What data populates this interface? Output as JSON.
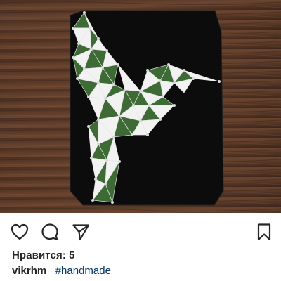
{
  "post": {
    "image_alt": "",
    "likes_label": "Нравится: 5",
    "username": "vikrhm_",
    "caption_tag": "#handmade"
  },
  "actions": {
    "like_icon": "heart-icon",
    "comment_icon": "comment-icon",
    "share_icon": "paper-plane-icon",
    "save_icon": "bookmark-icon"
  },
  "colors": {
    "text": "#262626",
    "hashtag": "#003569",
    "wood": "#5a3a28",
    "board": "#121212",
    "leaf_green": "#3e6b35"
  }
}
